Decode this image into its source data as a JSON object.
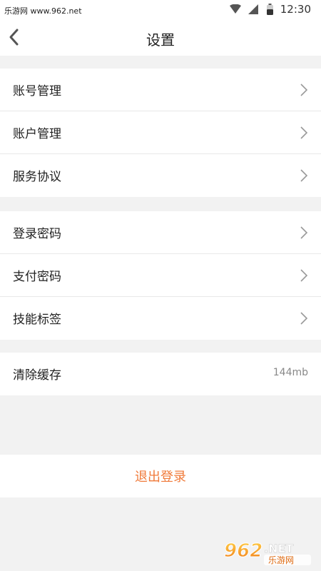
{
  "status_bar": {
    "site_text": "乐游网 www.962.net",
    "time": "12:30",
    "icons": [
      "wifi-icon",
      "signal-icon",
      "battery-icon"
    ]
  },
  "header": {
    "title": "设置",
    "back_icon": "chevron-left-icon"
  },
  "groups": [
    {
      "items": [
        {
          "label": "账号管理"
        },
        {
          "label": "账户管理"
        },
        {
          "label": "服务协议"
        }
      ]
    },
    {
      "items": [
        {
          "label": "登录密码"
        },
        {
          "label": "支付密码"
        },
        {
          "label": "技能标签"
        }
      ]
    },
    {
      "items": [
        {
          "label": "清除缓存",
          "value": "144mb"
        }
      ]
    }
  ],
  "logout": {
    "label": "退出登录",
    "color": "#f07a3a"
  },
  "watermark": {
    "main": "962.NET",
    "sub": "乐游网"
  }
}
